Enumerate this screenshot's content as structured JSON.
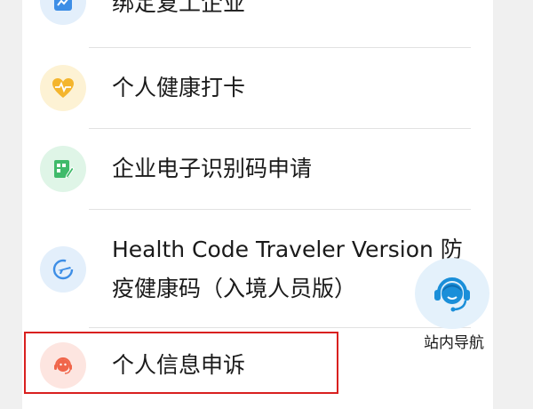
{
  "menu": {
    "items": [
      {
        "label": "绑定复工企业",
        "icon": "chart-trend-icon"
      },
      {
        "label": "个人健康打卡",
        "icon": "heart-pulse-icon"
      },
      {
        "label": "企业电子识别码申请",
        "icon": "qr-code-edit-icon"
      },
      {
        "label_line1": "Health Code Traveler Version 防",
        "label_line2": "疫健康码（入境人员版）",
        "icon": "airplane-icon"
      },
      {
        "label": "个人信息申诉",
        "icon": "customer-service-icon"
      }
    ]
  },
  "floating_nav": {
    "label": "站内导航",
    "icon": "headset-agent-icon"
  },
  "colors": {
    "blue_icon": "#3d8ee6",
    "blue_bg": "#e3effb",
    "yellow_icon": "#f4b52d",
    "yellow_bg": "#fdf2d4",
    "green_icon": "#3fba6a",
    "green_bg": "#dff5e7",
    "red_icon": "#f0654a",
    "red_bg": "#fde5e0",
    "highlight_border": "#d9201f"
  }
}
